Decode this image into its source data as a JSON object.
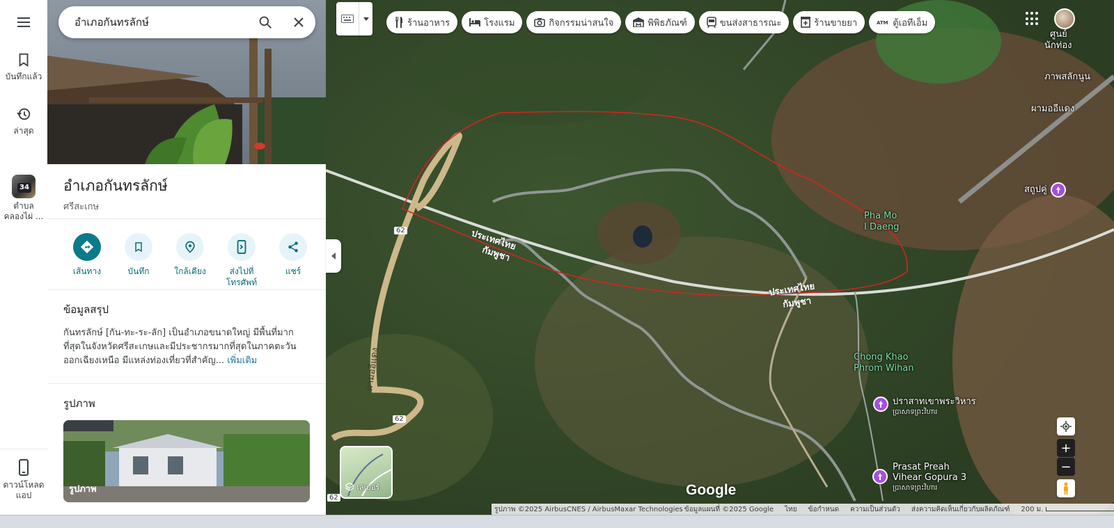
{
  "rail": {
    "saved_label": "บันทึกแล้ว",
    "recent_label": "ล่าสุด",
    "recent_item_badge": "34",
    "recent_item_label_1": "ตำบล",
    "recent_item_label_2": "คลองไผ่ ...",
    "download_label_1": "ดาวน์โหลด",
    "download_label_2": "แอป"
  },
  "search": {
    "value": "อำเภอกันทรลักษ์"
  },
  "place": {
    "title": "อำเภอกันทรลักษ์",
    "subtitle": "ศรีสะเกษ",
    "actions": [
      {
        "label": "เส้นทาง"
      },
      {
        "label": "บันทึก"
      },
      {
        "label": "ใกล้เคียง"
      },
      {
        "label_1": "ส่งไปที่",
        "label_2": "โทรศัพท์"
      },
      {
        "label": "แชร์"
      }
    ],
    "summary_heading": "ข้อมูลสรุป",
    "summary_text": "กันทรลักษ์ [กัน-ทะ-ระ-ลัก] เป็นอำเภอขนาดใหญ่ มีพื้นที่มากที่สุดในจังหวัดศรีสะเกษและมีประชากรมากที่สุดในภาคตะวันออกเฉียงเหนือ มีแหล่งท่องเที่ยวที่สำคัญ...",
    "more_link": "เพิ่มเติม",
    "photos_heading": "รูปภาพ",
    "photo_label": "รูปภาพ"
  },
  "chips": [
    {
      "label": "ร้านอาหาร",
      "icon": "restaurant-icon"
    },
    {
      "label": "โรงแรม",
      "icon": "hotel-icon"
    },
    {
      "label": "กิจกรรมน่าสนใจ",
      "icon": "camera-icon"
    },
    {
      "label": "พิพิธภัณฑ์",
      "icon": "museum-icon"
    },
    {
      "label": "ขนส่งสาธารณะ",
      "icon": "transit-icon"
    },
    {
      "label": "ร้านขายยา",
      "icon": "pharmacy-icon"
    },
    {
      "label": "ตู้เอทีเอ็ม",
      "icon": "atm-icon"
    }
  ],
  "map": {
    "labels": {
      "top_right_1": "ศูนย์",
      "top_right_2": "นักท่อง",
      "pictures": "ภาพสลักนูน",
      "pha_mo_e_daeng": "ผามออีแดง",
      "stupa": "สถูปคู่",
      "pha_mo_1": "Pha Mo",
      "pha_mo_2": "I Daeng",
      "chong_khao_1": "Chong Khao",
      "chong_khao_2": "Phrom Wihan",
      "prasat_th": "ปราสาทเขาพระวิหาร",
      "prasat_km": "ប្រាសាទព្រះវិហារ",
      "gopura_1": "Prasat Preah",
      "gopura_2": "Vihear Gopura 3",
      "gopura_km": "ប្រាសាទព្រះវិហារ",
      "thailand_1": "ประเทศไทย",
      "thailand_2": "ประเทศไทย",
      "cambodia": "กัมพูชา",
      "cambodia_2": "กัมพูชา",
      "road_1": "62",
      "road_2": "62",
      "road_3": "62",
      "road_name": "ผามออีแดง"
    },
    "layers_label": "เลเยอร์",
    "logo": "Google",
    "footer": {
      "imagery": "รูปภาพ ©2025 AirbusCNES / AirbusMaxar Technologies",
      "mapdata": "ข้อมูลแผนที่ ©2025 Google",
      "country": "ไทย",
      "terms": "ข้อกำหนด",
      "privacy": "ความเป็นส่วนตัว",
      "feedback": "ส่งความคิดเห็นเกี่ยวกับผลิตภัณฑ์",
      "scale": "200 ม."
    }
  }
}
